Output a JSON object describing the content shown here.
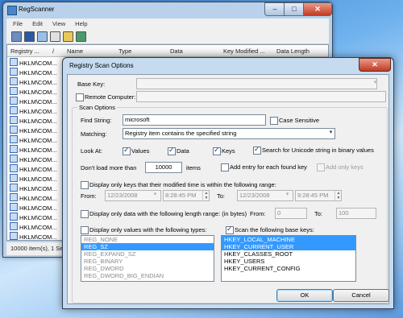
{
  "main_window": {
    "title": "RegScanner",
    "menu": [
      "File",
      "Edit",
      "View",
      "Help"
    ],
    "columns": [
      "Registry ...",
      "/",
      "Name",
      "Type",
      "Data",
      "Key Modified ...",
      "Data Length"
    ],
    "row_text": "HKLM\\COM...",
    "row_count_visible": 19,
    "status_text": "10000 item(s), 1 Selec"
  },
  "dialog": {
    "title": "Registry Scan Options",
    "base_key_label": "Base Key:",
    "base_key_value": "",
    "remote_computer_label": "Remote Computer:",
    "remote_computer_value": "",
    "scan_options_label": "Scan Options",
    "find_string_label": "Find String:",
    "find_string_value": "microsoft",
    "case_sensitive_label": "Case Sensitive",
    "matching_label": "Matching:",
    "matching_value": "Registry item contains the specified string",
    "look_at_label": "Look At:",
    "look_values_label": "Values",
    "look_data_label": "Data",
    "look_keys_label": "Keys",
    "unicode_label": "Search for Unicode string in binary values",
    "dont_load_label": "Don't load more than",
    "dont_load_value": "10000",
    "items_label": "items",
    "add_entry_label": "Add entry for each found key",
    "add_only_keys_label": "Add only keys",
    "modified_range_label": "Display only keys that their modified time is within the following range:",
    "from_label": "From:",
    "to_label": "To:",
    "from_date": "12/23/2008",
    "from_time": "8:28:45 PM",
    "to_date": "12/23/2008",
    "to_time": "9:28:45 PM",
    "length_range_label": "Display only data with the following length range: (in bytes)",
    "len_from_label": "From:",
    "len_from_value": "0",
    "len_to_label": "To:",
    "len_to_value": "100",
    "types_label": "Display only values with the following types:",
    "types": [
      "REG_NONE",
      "REG_SZ",
      "REG_EXPAND_SZ",
      "REG_BINARY",
      "REG_DWORD",
      "REG_DWORD_BIG_ENDIAN"
    ],
    "base_keys_label": "Scan the following base keys:",
    "base_keys": [
      "HKEY_LOCAL_MACHINE",
      "HKEY_CURRENT_USER",
      "HKEY_CLASSES_ROOT",
      "HKEY_USERS",
      "HKEY_CURRENT_CONFIG"
    ],
    "ok_label": "OK",
    "cancel_label": "Cancel"
  },
  "colors": {
    "selection": "#3399ff",
    "close_button": "#c23b22",
    "window_frame": "#b9d1ea"
  }
}
